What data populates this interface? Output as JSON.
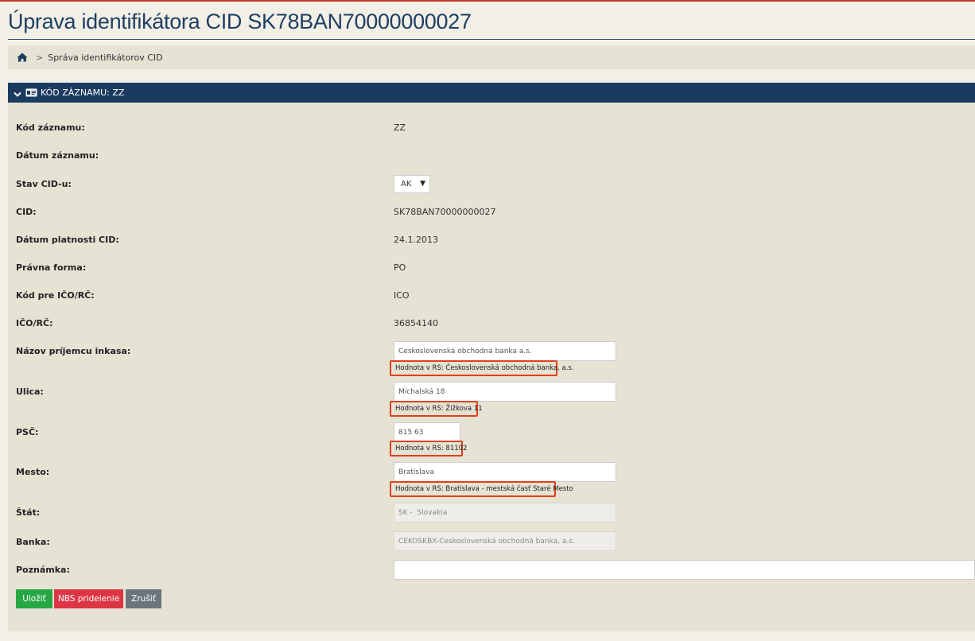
{
  "page": {
    "title": "Úprava identifikátora CID SK78BAN70000000027"
  },
  "breadcrumb": {
    "separator": ">",
    "current": "Správa identifikátorov CID"
  },
  "panel": {
    "title": "KÓD ZÁZNAMU: ZZ"
  },
  "form": {
    "kod_zaznamu": {
      "label": "Kód záznamu:",
      "value": "ZZ"
    },
    "datum_zaznamu": {
      "label": "Dátum záznamu:",
      "value": ""
    },
    "stav_cid": {
      "label": "Stav CID-u:",
      "selected": "AK"
    },
    "cid": {
      "label": "CID:",
      "value": "SK78BAN70000000027"
    },
    "datum_platnosti": {
      "label": "Dátum platnosti CID:",
      "value": "24.1.2013"
    },
    "pravna_forma": {
      "label": "Právna forma:",
      "value": "PO"
    },
    "kod_ico": {
      "label": "Kód pre IČO/RČ:",
      "value": "ICO"
    },
    "ico": {
      "label": "IČO/RČ:",
      "value": "36854140"
    },
    "nazov": {
      "label": "Názov príjemcu inkasa:",
      "value": "Československá obchodná banka a.s.",
      "rs_hint": "Hodnota v RS: Československá obchodná banka, a.s."
    },
    "ulica": {
      "label": "Ulica:",
      "value": "Michalská 18",
      "rs_hint": "Hodnota v RS: Žižkova 11"
    },
    "psc": {
      "label": "PSČ:",
      "value": "815 63",
      "rs_hint": "Hodnota v RS: 81102"
    },
    "mesto": {
      "label": "Mesto:",
      "value": "Bratislava",
      "rs_hint": "Hodnota v RS: Bratislava - mestská časť Staré Mesto"
    },
    "stat": {
      "label": "Štát:",
      "value": "SK -  Slovakia"
    },
    "banka": {
      "label": "Banka:",
      "value": "CEKOSKBX-Československá obchodná banka, a.s."
    },
    "poznamka": {
      "label": "Poznámka:",
      "value": ""
    }
  },
  "buttons": {
    "save": "Uložiť",
    "nbs": "NBS pridelenie",
    "cancel": "Zrušiť"
  },
  "colors": {
    "header_bg": "#1b3a5f",
    "highlight_border": "#e0401c",
    "save": "#28a745",
    "nbs": "#dc3545",
    "cancel": "#6c757d"
  }
}
